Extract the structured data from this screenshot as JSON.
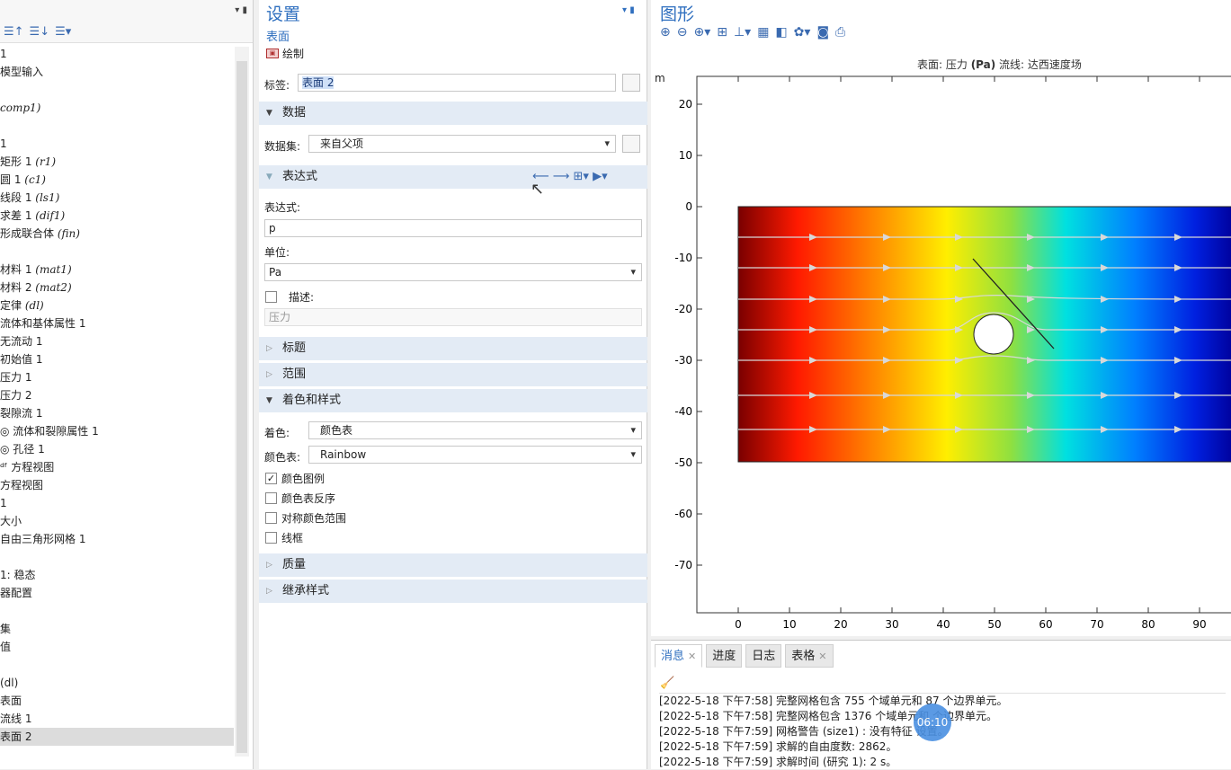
{
  "tree": {
    "rows": [
      {
        "text": "1",
        "em": ""
      },
      {
        "text": "模型输入",
        "em": ""
      },
      {
        "text": "",
        "em": ""
      },
      {
        "text": "",
        "em": "comp1)"
      },
      {
        "text": "",
        "em": ""
      },
      {
        "text": "1",
        "em": ""
      },
      {
        "text": "矩形 1 ",
        "em": "(r1)"
      },
      {
        "text": "圆 1 ",
        "em": "(c1)"
      },
      {
        "text": "线段 1 ",
        "em": "(ls1)"
      },
      {
        "text": "求差 1 ",
        "em": "(dif1)"
      },
      {
        "text": "形成联合体 ",
        "em": "(fin)"
      },
      {
        "text": "",
        "em": ""
      },
      {
        "text": "材料 1 ",
        "em": "(mat1)"
      },
      {
        "text": "材料 2 ",
        "em": "(mat2)"
      },
      {
        "text": "定律 ",
        "em": "(dl)"
      },
      {
        "text": "流体和基体属性 1",
        "em": ""
      },
      {
        "text": "无流动 1",
        "em": ""
      },
      {
        "text": "初始值 1",
        "em": ""
      },
      {
        "text": "压力 1",
        "em": ""
      },
      {
        "text": "压力 2",
        "em": ""
      },
      {
        "text": "裂隙流 1",
        "em": ""
      },
      {
        "text": "◎ 流体和裂隙属性 1",
        "em": ""
      },
      {
        "text": "◎ 孔径 1",
        "em": ""
      },
      {
        "text": "ᵈᶠ 方程视图",
        "em": ""
      },
      {
        "text": "方程视图",
        "em": ""
      },
      {
        "text": "1",
        "em": ""
      },
      {
        "text": "大小",
        "em": ""
      },
      {
        "text": "自由三角形网格 1",
        "em": ""
      },
      {
        "text": "",
        "em": ""
      },
      {
        "text": "1: 稳态",
        "em": ""
      },
      {
        "text": "器配置",
        "em": ""
      },
      {
        "text": "",
        "em": ""
      },
      {
        "text": "集",
        "em": ""
      },
      {
        "text": "值",
        "em": ""
      },
      {
        "text": "",
        "em": ""
      },
      {
        "text": "(dl)",
        "em": ""
      },
      {
        "text": "表面",
        "em": ""
      },
      {
        "text": "流线 1",
        "em": ""
      },
      {
        "text": "表面 2",
        "em": ""
      }
    ],
    "selected_index": 38
  },
  "settings": {
    "title": "设置",
    "subtitle": "表面",
    "plot_label": "绘制",
    "label_caption": "标签:",
    "label_value": "表面 2",
    "sections": {
      "data": "数据",
      "expression": "表达式",
      "title": "标题",
      "range": "范围",
      "coloring": "着色和样式",
      "quality": "质量",
      "inherit": "继承样式"
    },
    "dataset_caption": "数据集:",
    "dataset_value": "来自父项",
    "expr_caption": "表达式:",
    "expr_value": "p",
    "unit_caption": "单位:",
    "unit_value": "Pa",
    "desc_caption": "描述:",
    "desc_value": "压力",
    "coloring_caption": "着色:",
    "coloring_value": "颜色表",
    "colortable_caption": "颜色表:",
    "colortable_value": "Rainbow",
    "checks": [
      {
        "label": "颜色图例",
        "checked": true
      },
      {
        "label": "颜色表反序",
        "checked": false
      },
      {
        "label": "对称颜色范围",
        "checked": false
      },
      {
        "label": "线框",
        "checked": false
      }
    ]
  },
  "graphics": {
    "title": "图形",
    "caption_prefix": "表面: 压力 ",
    "caption_unit": "(Pa)",
    "caption_suffix": "  流线: 达西速度场",
    "axis_unit": "m",
    "x_ticks": [
      "0",
      "10",
      "20",
      "30",
      "40",
      "50",
      "60",
      "70",
      "80",
      "90"
    ],
    "y_ticks": [
      "20",
      "10",
      "0",
      "-10",
      "-20",
      "-30",
      "-40",
      "-50",
      "-60",
      "-70"
    ]
  },
  "messages": {
    "tabs": [
      "消息",
      "进度",
      "日志",
      "表格"
    ],
    "lines": [
      "[2022-5-18 下午7:58] 完整网格包含 755 个域单元和 87 个边界单元。",
      "[2022-5-18 下午7:58] 完整网格包含 1376 个域单元和 个边界单元。",
      "[2022-5-18 下午7:59] 网格警告 (size1) : 没有特征 设置。",
      "[2022-5-18 下午7:59] 求解的自由度数: 2862。",
      "[2022-5-18 下午7:59] 求解时间 (研究 1): 2 s。"
    ],
    "timer": "06:10"
  },
  "colors": {
    "accent": "#2f6fbf",
    "section_bg": "#e3ebf5"
  }
}
